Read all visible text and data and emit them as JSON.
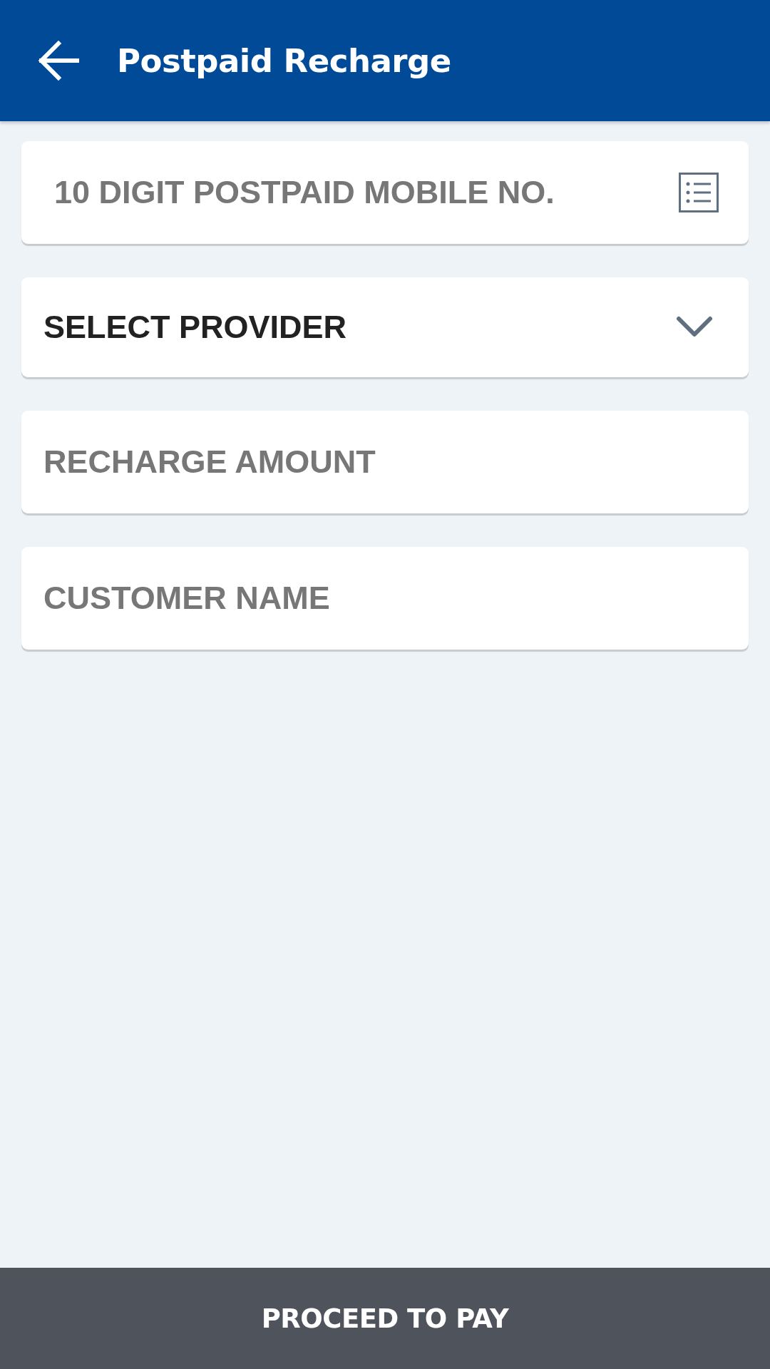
{
  "header": {
    "title": "Postpaid Recharge"
  },
  "fields": [
    {
      "kind": "phone",
      "placeholder": "10 DIGIT POSTPAID MOBILE NO."
    },
    {
      "kind": "select",
      "value": "SELECT PROVIDER"
    },
    {
      "kind": "text",
      "placeholder": "RECHARGE AMOUNT"
    },
    {
      "kind": "text",
      "placeholder": "CUSTOMER NAME"
    }
  ],
  "footer_button": {
    "label": "PROCEED TO PAY"
  }
}
